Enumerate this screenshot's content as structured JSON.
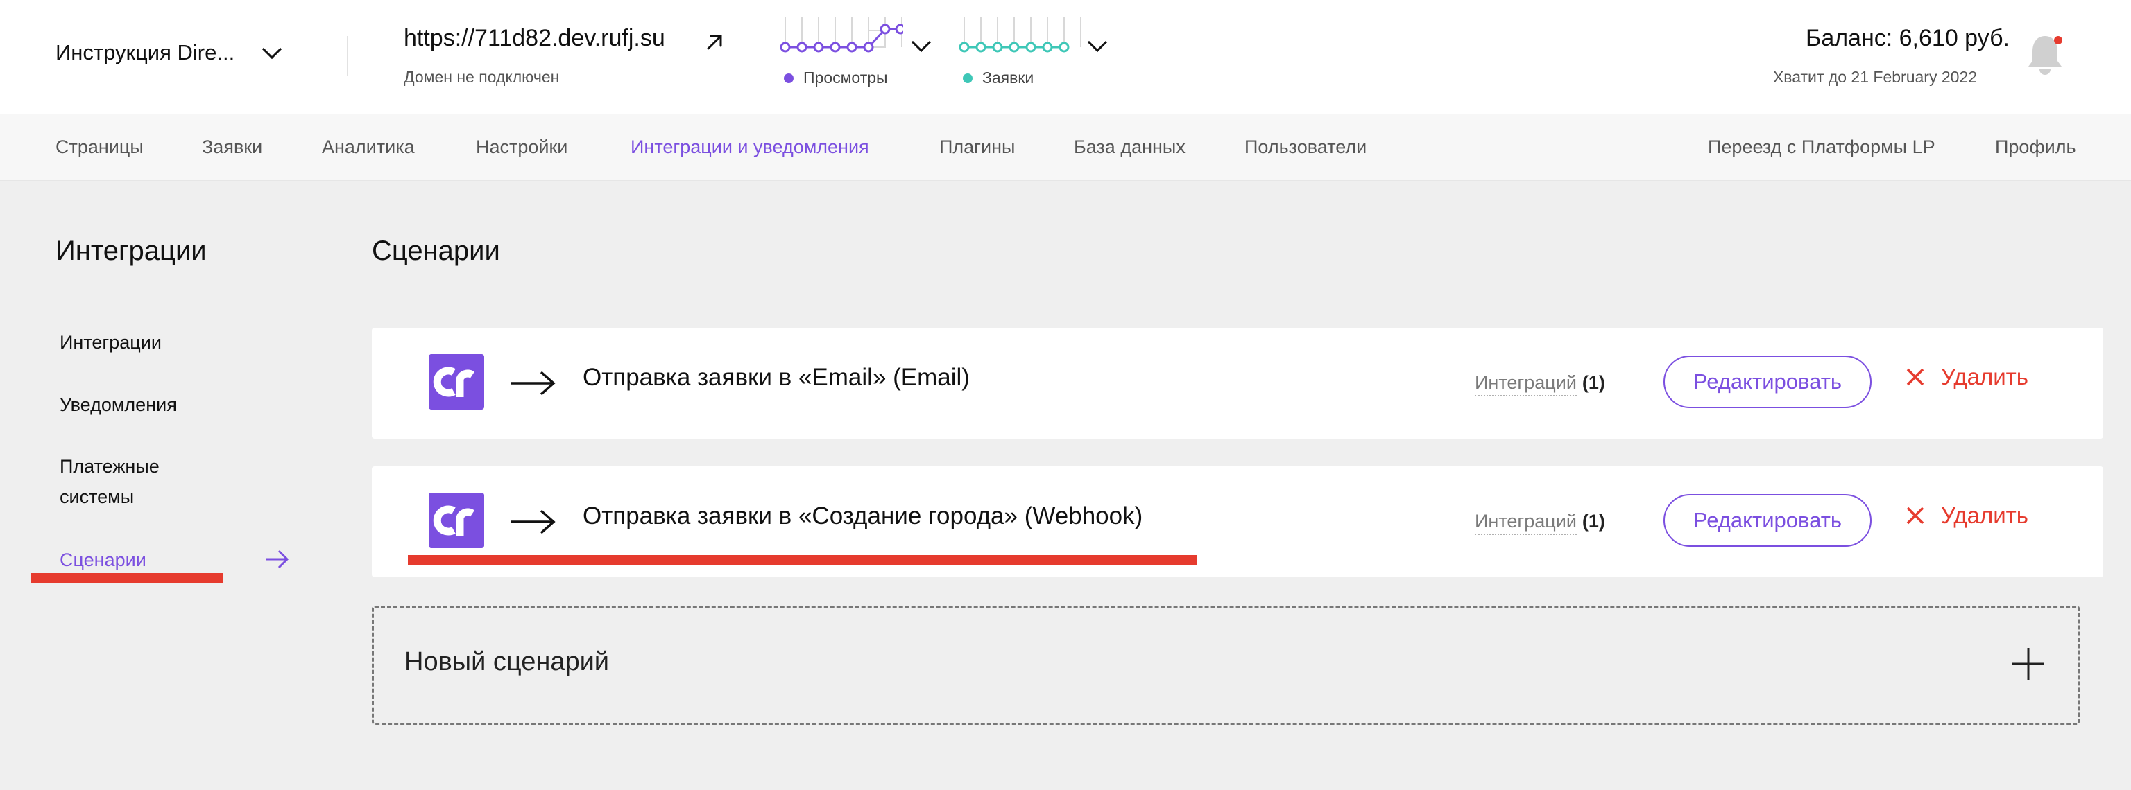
{
  "header": {
    "site_name": "Инструкция Dire...",
    "domain_url": "https://711d82.dev.rufj.su",
    "domain_status": "Домен не подключен",
    "views_label": "Просмотры",
    "leads_label": "Заявки",
    "views_color": "#7b4fe0",
    "leads_color": "#3ec7b7",
    "balance": "Баланс: 6,610 руб.",
    "balance_until": "Хватит до 21 February 2022"
  },
  "nav": {
    "items": [
      {
        "label": "Страницы"
      },
      {
        "label": "Заявки"
      },
      {
        "label": "Аналитика"
      },
      {
        "label": "Настройки"
      },
      {
        "label": "Интеграции и уведомления"
      },
      {
        "label": "Плагины"
      },
      {
        "label": "База данных"
      },
      {
        "label": "Пользователи"
      }
    ],
    "active_index": 4,
    "right_items": [
      {
        "label": "Переезд с Платформы LP"
      },
      {
        "label": "Профиль"
      }
    ]
  },
  "sidebar": {
    "title": "Интеграции",
    "items": [
      {
        "label": "Интеграции"
      },
      {
        "label": "Уведомления"
      },
      {
        "label": "Платежные системы"
      },
      {
        "label": "Сценарии"
      }
    ],
    "active_index": 3
  },
  "main": {
    "title": "Сценарии",
    "scenarios": [
      {
        "name": "Отправка заявки в «Email» (Email)",
        "integrations_label": "Интеграций",
        "integrations_count": "(1)",
        "edit_label": "Редактировать",
        "delete_label": "Удалить"
      },
      {
        "name": "Отправка заявки в «Создание города» (Webhook)",
        "integrations_label": "Интеграций",
        "integrations_count": "(1)",
        "edit_label": "Редактировать",
        "delete_label": "Удалить"
      }
    ],
    "new_scenario_label": "Новый сценарий"
  },
  "colors": {
    "accent": "#7b4fe0",
    "danger": "#e63b2e",
    "highlight_marker": "#e63b2e"
  },
  "icons": {
    "external_link": "arrow-up-right-icon",
    "notifications": "bell-icon",
    "scenario_logo": "cr-logo-icon",
    "flow": "arrow-right-icon",
    "delete": "close-icon",
    "add": "plus-icon"
  }
}
